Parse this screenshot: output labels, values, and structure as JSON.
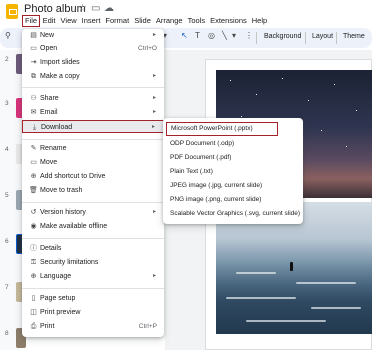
{
  "app": {
    "title": "Photo album"
  },
  "menubar": {
    "items": [
      "File",
      "Edit",
      "View",
      "Insert",
      "Format",
      "Slide",
      "Arrange",
      "Tools",
      "Extensions",
      "Help"
    ]
  },
  "toolbar": {
    "background": "Background",
    "layout": "Layout",
    "theme": "Theme"
  },
  "filmstrip": {
    "numbers": [
      "2",
      "3",
      "4",
      "5",
      "6",
      "7",
      "8"
    ]
  },
  "file_menu": {
    "items": [
      {
        "label": "New",
        "icon": "document-icon",
        "shortcut": "",
        "submenu": true
      },
      {
        "label": "Open",
        "icon": "folder-icon",
        "shortcut": "Ctrl+O",
        "submenu": false
      },
      {
        "label": "Import slides",
        "icon": "import-icon",
        "shortcut": "",
        "submenu": false
      },
      {
        "label": "Make a copy",
        "icon": "copy-icon",
        "shortcut": "",
        "submenu": true
      },
      {
        "label": "Share",
        "icon": "share-icon",
        "shortcut": "",
        "submenu": true
      },
      {
        "label": "Email",
        "icon": "email-icon",
        "shortcut": "",
        "submenu": true
      },
      {
        "label": "Download",
        "icon": "download-icon",
        "shortcut": "",
        "submenu": true
      },
      {
        "label": "Rename",
        "icon": "rename-icon",
        "shortcut": "",
        "submenu": false
      },
      {
        "label": "Move",
        "icon": "move-icon",
        "shortcut": "",
        "submenu": false
      },
      {
        "label": "Add shortcut to Drive",
        "icon": "drive-shortcut-icon",
        "shortcut": "",
        "submenu": false
      },
      {
        "label": "Move to trash",
        "icon": "trash-icon",
        "shortcut": "",
        "submenu": false
      },
      {
        "label": "Version history",
        "icon": "history-icon",
        "shortcut": "",
        "submenu": true
      },
      {
        "label": "Make available offline",
        "icon": "offline-icon",
        "shortcut": "",
        "submenu": false
      },
      {
        "label": "Details",
        "icon": "info-icon",
        "shortcut": "",
        "submenu": false
      },
      {
        "label": "Security limitations",
        "icon": "lock-icon",
        "shortcut": "",
        "submenu": false
      },
      {
        "label": "Language",
        "icon": "globe-icon",
        "shortcut": "",
        "submenu": true
      },
      {
        "label": "Page setup",
        "icon": "page-setup-icon",
        "shortcut": "",
        "submenu": false
      },
      {
        "label": "Print preview",
        "icon": "preview-icon",
        "shortcut": "",
        "submenu": false
      },
      {
        "label": "Print",
        "icon": "print-icon",
        "shortcut": "Ctrl+P",
        "submenu": false
      }
    ]
  },
  "download_menu": {
    "items": [
      "Microsoft PowerPoint (.pptx)",
      "ODP Document (.odp)",
      "PDF Document (.pdf)",
      "Plain Text (.txt)",
      "JPEG image (.jpg, current slide)",
      "PNG image (.png, current slide)",
      "Scalable Vector Graphics (.svg, current slide)"
    ]
  },
  "colors": {
    "highlight_border": "#a52228",
    "app_accent": "#f4b400",
    "toolbar_bg": "#edf2fa"
  }
}
